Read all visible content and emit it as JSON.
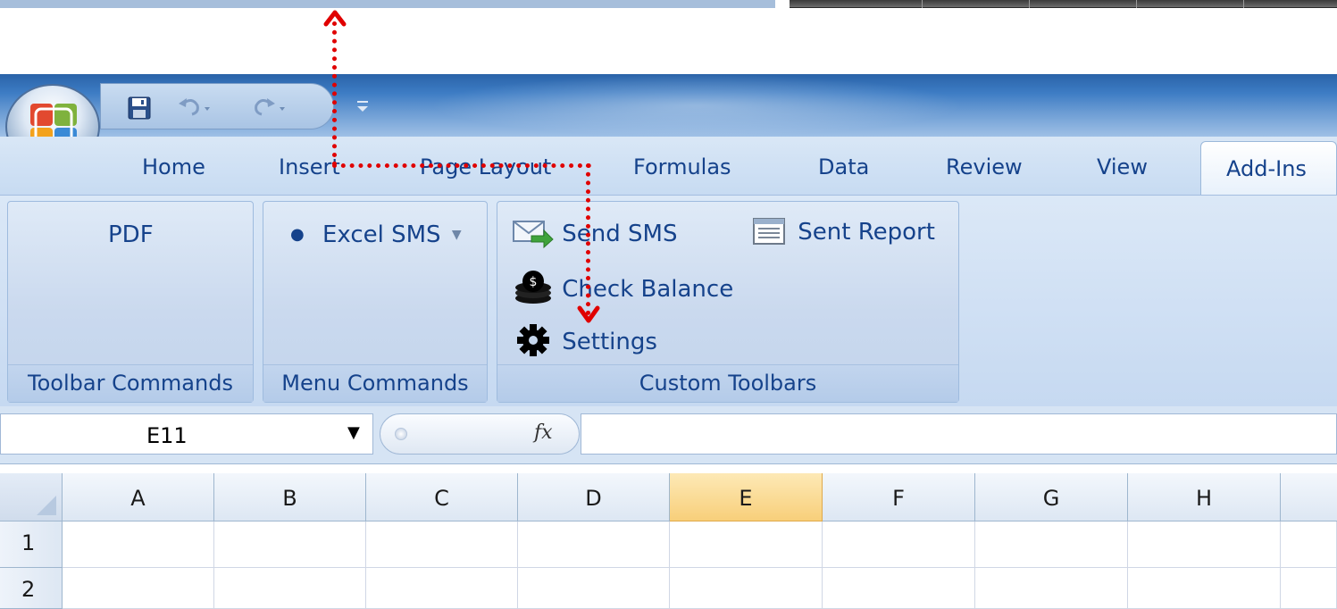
{
  "quick_access": {
    "save_icon": "save-icon",
    "undo_icon": "undo-icon",
    "redo_icon": "redo-icon",
    "customize_icon": "customize-qat-icon"
  },
  "tabs": [
    {
      "label": "Home"
    },
    {
      "label": "Insert"
    },
    {
      "label": "Page Layout"
    },
    {
      "label": "Formulas"
    },
    {
      "label": "Data"
    },
    {
      "label": "Review"
    },
    {
      "label": "View"
    },
    {
      "label": "Add-Ins",
      "active": true
    }
  ],
  "ribbon": {
    "toolbar_commands": {
      "pdf_label": "PDF",
      "group_label": "Toolbar Commands"
    },
    "menu_commands": {
      "excel_sms_label": "Excel SMS",
      "group_label": "Menu Commands"
    },
    "custom_toolbars": {
      "send_sms_label": "Send SMS",
      "sent_report_label": "Sent Report",
      "check_balance_label": "Check Balance",
      "settings_label": "Settings",
      "group_label": "Custom Toolbars"
    }
  },
  "formula_bar": {
    "name_box": "E11",
    "fx_label": "fx",
    "formula": ""
  },
  "sheet": {
    "columns": [
      "A",
      "B",
      "C",
      "D",
      "E",
      "F",
      "G",
      "H"
    ],
    "selected_column": "E",
    "rows": [
      "1",
      "2"
    ]
  },
  "colors": {
    "annotation_arrow": "#e00000",
    "ribbon_text": "#15428b",
    "selected_header": "#f8cf7a"
  }
}
